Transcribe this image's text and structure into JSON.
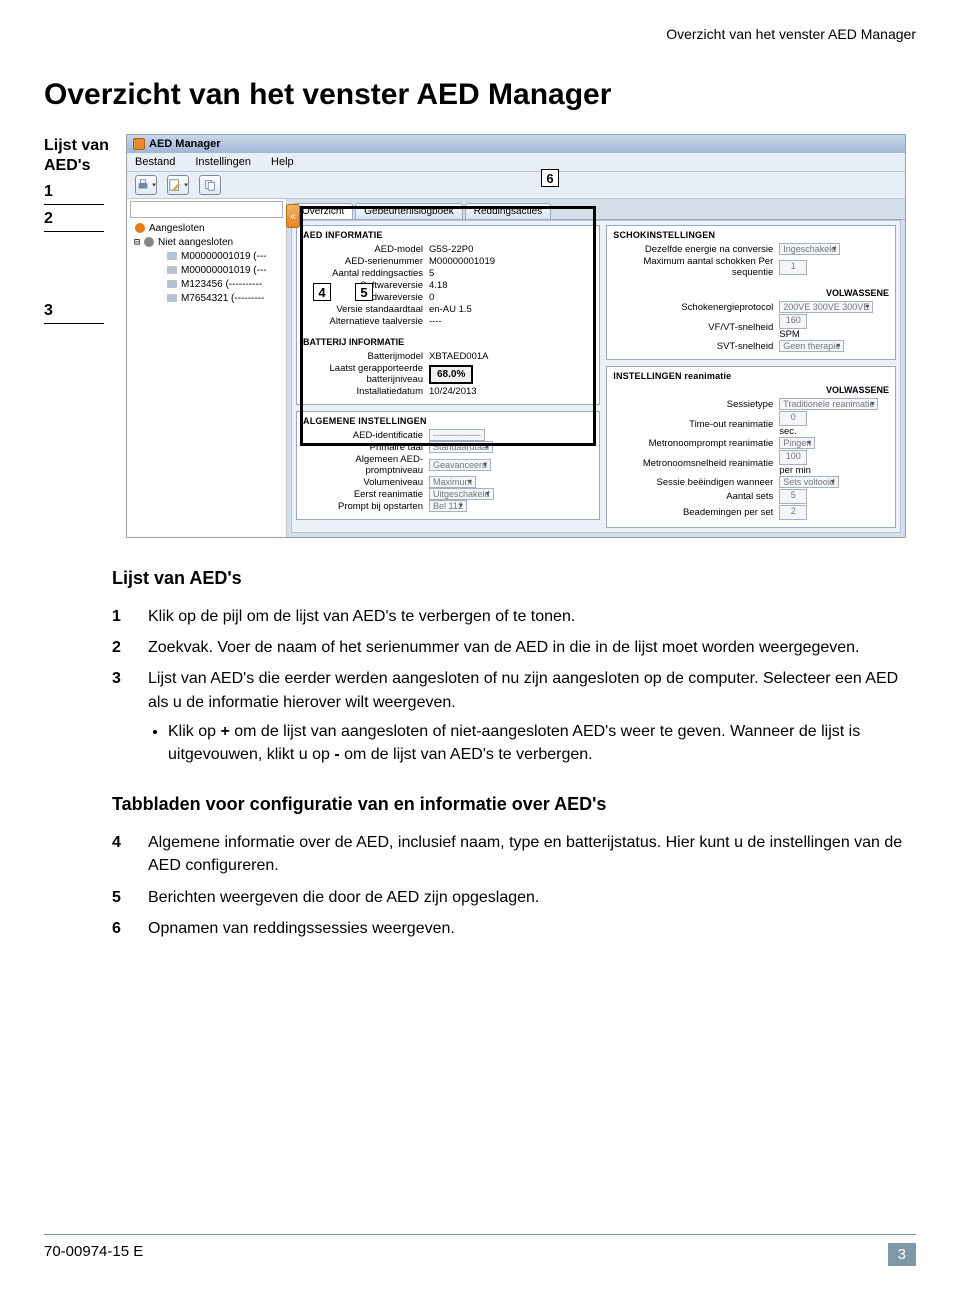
{
  "running_head": "Overzicht van het venster AED Manager",
  "page_title": "Overzicht van het venster AED Manager",
  "left_labels": {
    "title": "Lijst van AED's",
    "n1": "1",
    "n2": "2",
    "n3": "3"
  },
  "app": {
    "title": "AED Manager",
    "menu": [
      "Bestand",
      "Instellingen",
      "Help"
    ],
    "sidebar": {
      "connected_label": "Aangesloten",
      "not_connected_label": "Niet aangesloten",
      "items": [
        "M00000001019 (---",
        "M00000001019 (---",
        "M123456 (----------",
        "M7654321 (---------"
      ]
    },
    "tabs": {
      "t1": "Overzicht",
      "t2": "Gebeurtenislogboek",
      "t3": "Reddingsacties"
    },
    "aed_info": {
      "title": "AED INFORMATIE",
      "rows": [
        {
          "k": "AED-model",
          "v": "G5S-22P0"
        },
        {
          "k": "AED-serienummer",
          "v": "M00000001019"
        },
        {
          "k": "Aantal reddingsacties",
          "v": "5"
        },
        {
          "k": "Softwareversie",
          "v": "4.18"
        },
        {
          "k": "Hardwareversie",
          "v": "0"
        },
        {
          "k": "Versie standaardtaal",
          "v": "en-AU  1.5"
        },
        {
          "k": "Alternatieve taalversie",
          "v": "----"
        }
      ]
    },
    "batt_info": {
      "title": "BATTERIJ INFORMATIE",
      "rows": [
        {
          "k": "Batterijmodel",
          "v": "XBTAED001A"
        },
        {
          "k": "Laatst gerapporteerde batterijniveau",
          "v": "68.0%"
        },
        {
          "k": "Installatiedatum",
          "v": "10/24/2013"
        }
      ]
    },
    "general": {
      "title": "ALGEMENE INSTELLINGEN",
      "rows": [
        {
          "k": "AED-identificatie",
          "v": "----------------"
        },
        {
          "k": "Primaire taal",
          "v": "Standaardtaal"
        },
        {
          "k": "Algemeen AED-promptniveau",
          "v": "Geavanceerd"
        },
        {
          "k": "Volumeniveau",
          "v": "Maximum"
        },
        {
          "k": "Eerst reanimatie",
          "v": "Uitgeschakeld"
        },
        {
          "k": "Prompt bij opstarten",
          "v": "Bel 112"
        }
      ]
    },
    "shock": {
      "title": "SCHOKINSTELLINGEN",
      "rows": [
        {
          "k": "Dezelfde energie na conversie",
          "v": "Ingeschakeld"
        },
        {
          "k": "Maximum aantal schokken Per sequentie",
          "v": "1"
        }
      ],
      "adult_title": "VOLWASSENE",
      "adult_rows": [
        {
          "k": "Schokenergieprotocol",
          "v": "200VE 300VE 300VE"
        },
        {
          "k": "VF/VT-snelheid",
          "v": "160",
          "unit": "SPM"
        },
        {
          "k": "SVT-snelheid",
          "v": "Geen therapie"
        }
      ]
    },
    "cpr": {
      "title": "INSTELLINGEN reanimatie",
      "rows": [
        {
          "k": "Sessietype",
          "v": "Traditionele reanimatie"
        },
        {
          "k": "Time-out reanimatie",
          "v": "0",
          "unit": "sec."
        },
        {
          "k": "Metronoomprompt reanimatie",
          "v": "Pingen"
        },
        {
          "k": "Metronoomsnelheid reanimatie",
          "v": "100",
          "unit": "per min"
        },
        {
          "k": "Sessie beëindigen wanneer",
          "v": "Sets voltooid"
        },
        {
          "k": "Aantal sets",
          "v": "5"
        },
        {
          "k": "Beademingen per set",
          "v": "2"
        }
      ],
      "adult_title": "VOLWASSENE"
    }
  },
  "annot": {
    "n4": "4",
    "n5": "5",
    "n6": "6"
  },
  "body": {
    "h_list": "Lijst van AED's",
    "r1": "Klik op de pijl om de lijst van AED's te verbergen of te tonen.",
    "r2": "Zoekvak. Voer de naam of het serienummer van de AED in die in de lijst moet worden weergegeven.",
    "r3a": "Lijst van AED's die eerder werden aangesloten of nu zijn aangesloten op de computer. Selecteer een AED als u de informatie hierover wilt weergeven.",
    "r3b_pre": "Klik op ",
    "r3b_plus": "+",
    "r3b_mid": " om de lijst van aangesloten of niet-aangesloten AED's weer te geven. Wanneer de lijst is uitgevouwen, klikt u op ",
    "r3b_minus": "-",
    "r3b_post": " om de lijst van AED's te verbergen.",
    "h_tabs": "Tabbladen voor configuratie van en informatie over AED's",
    "r4": "Algemene informatie over de AED, inclusief naam, type en batterijstatus. Hier kunt u de instellingen van de AED configureren.",
    "r5": "Berichten weergeven die door de AED zijn opgeslagen.",
    "r6": "Opnamen van reddingssessies weergeven.",
    "n1": "1",
    "n2": "2",
    "n3": "3",
    "n4": "4",
    "n5": "5",
    "n6": "6"
  },
  "footer": {
    "doc": "70-00974-15 E",
    "page": "3"
  }
}
